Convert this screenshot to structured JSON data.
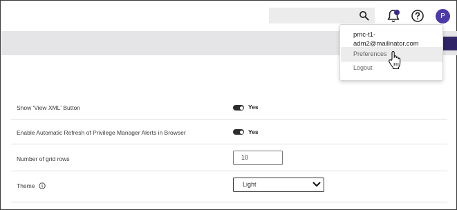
{
  "header": {
    "search": {
      "placeholder": ""
    },
    "icons": [
      "search-icon",
      "bell-icon",
      "help-icon"
    ],
    "avatar_initial": "P",
    "accent_color": "#4b3aa8"
  },
  "user_menu": {
    "email": "pmc-t1-adm2@mailinator.com",
    "items": [
      {
        "label": "Preferences"
      },
      {
        "label": "Logout"
      }
    ]
  },
  "settings": {
    "show_view_xml": {
      "label": "Show 'View XML' Button",
      "value": "Yes"
    },
    "auto_refresh": {
      "label": "Enable Automatic Refresh of Privilege Manager Alerts in Browser",
      "value": "Yes"
    },
    "grid_rows": {
      "label": "Number of grid rows",
      "value": "10"
    },
    "theme": {
      "label": "Theme",
      "value": "Light"
    }
  }
}
